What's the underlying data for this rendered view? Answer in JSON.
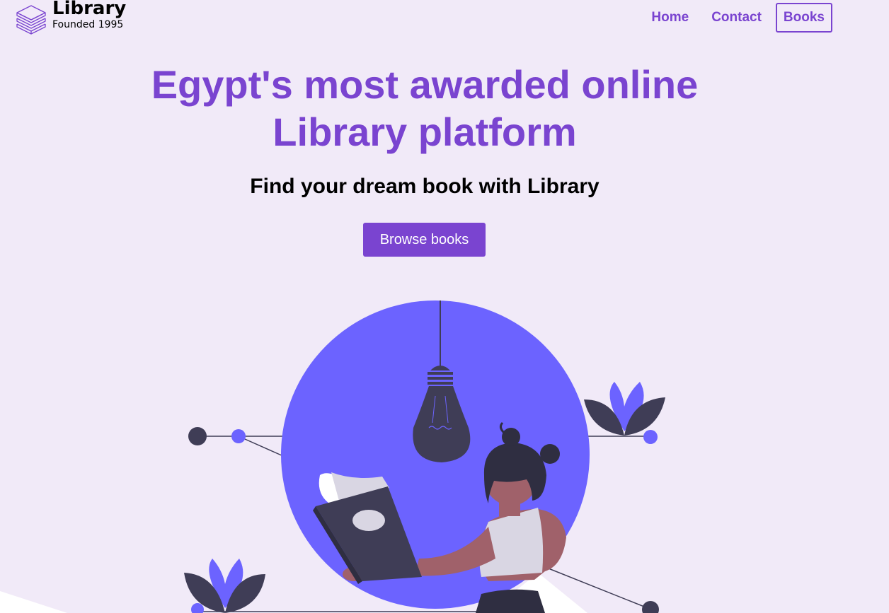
{
  "header": {
    "logo_title": "Library",
    "logo_subtitle": "Founded 1995",
    "nav": {
      "home": "Home",
      "contact": "Contact",
      "books": "Books"
    }
  },
  "hero": {
    "title": "Egypt's most awarded online Library platform",
    "subtitle": "Find your dream book with Library",
    "cta": "Browse books"
  },
  "colors": {
    "background": "#f1eaf8",
    "accent": "#7a44d0",
    "illustration_primary": "#6c63ff",
    "illustration_dark": "#3f3d56"
  },
  "icons": {
    "logo": "stacked-books-icon"
  }
}
